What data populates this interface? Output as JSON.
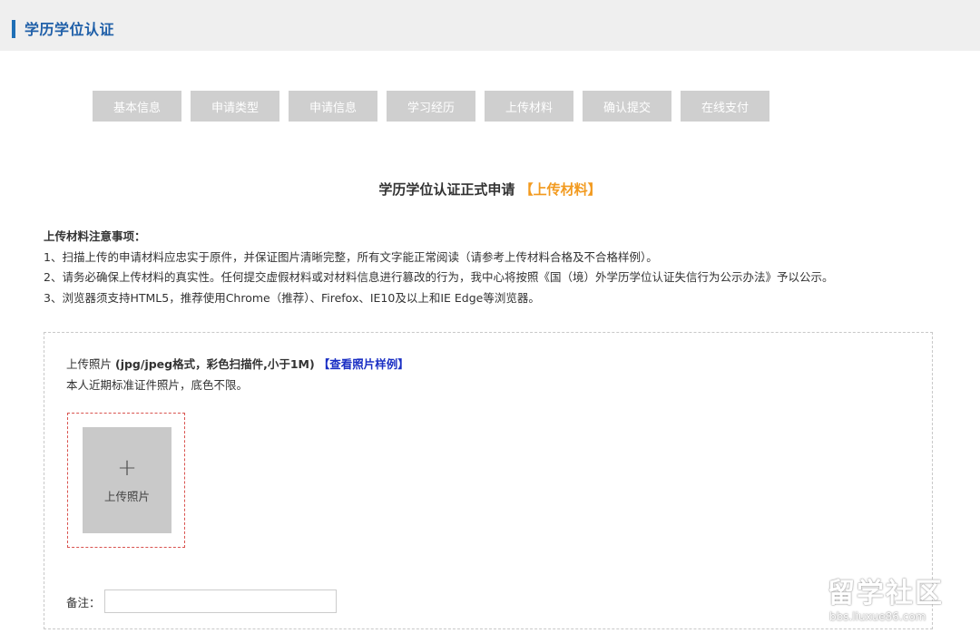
{
  "header": {
    "title": "学历学位认证"
  },
  "steps": [
    "基本信息",
    "申请类型",
    "申请信息",
    "学习经历",
    "上传材料",
    "确认提交",
    "在线支付"
  ],
  "form": {
    "title": "学历学位认证正式申请",
    "highlight": "【上传材料】"
  },
  "notes": {
    "heading": "上传材料注意事项：",
    "items": [
      "1、扫描上传的申请材料应忠实于原件，并保证图片清晰完整，所有文字能正常阅读（请参考上传材料合格及不合格样例）。",
      "2、请务必确保上传材料的真实性。任何提交虚假材料或对材料信息进行篡改的行为，我中心将按照《国（境）外学历学位认证失信行为公示办法》予以公示。",
      "3、浏览器须支持HTML5，推荐使用Chrome（推荐）、Firefox、IE10及以上和IE Edge等浏览器。"
    ]
  },
  "upload": {
    "label_prefix": "上传照片 ",
    "label_format": "(jpg/jpeg格式，彩色扫描件,小于1M)",
    "sample_link": "【查看照片样例】",
    "subtitle": "本人近期标准证件照片，底色不限。",
    "plus": "+",
    "button_label": "上传照片",
    "remark_label": "备注：",
    "remark_value": ""
  },
  "watermark": {
    "line1": "留学社区",
    "line2": "bbs.liuxue86.com"
  }
}
